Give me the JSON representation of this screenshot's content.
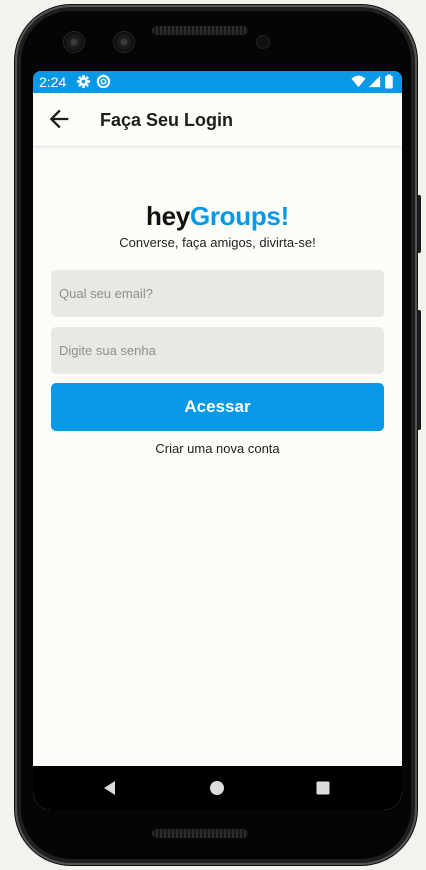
{
  "status_bar": {
    "time": "2:24",
    "icons": [
      "settings-gear-icon",
      "data-saver-icon",
      "wifi-icon",
      "cellular-signal-icon",
      "battery-icon"
    ]
  },
  "app_bar": {
    "back_icon": "arrow-left-icon",
    "title": "Faça Seu Login"
  },
  "brand": {
    "prefix": "hey",
    "suffix": "Groups!",
    "tagline": "Converse, faça amigos, divirta-se!"
  },
  "form": {
    "email_placeholder": "Qual seu email?",
    "email_value": "",
    "password_placeholder": "Digite sua senha",
    "password_value": "",
    "submit_label": "Acessar",
    "create_account_label": "Criar uma nova conta"
  },
  "nav_bar": {
    "icons": [
      "nav-back-icon",
      "nav-home-icon",
      "nav-recents-icon"
    ]
  },
  "colors": {
    "accent": "#0898e6",
    "input_bg": "#e9e9e4",
    "screen_bg": "#fdfdf8",
    "device_frame": "#1f1f1f"
  }
}
